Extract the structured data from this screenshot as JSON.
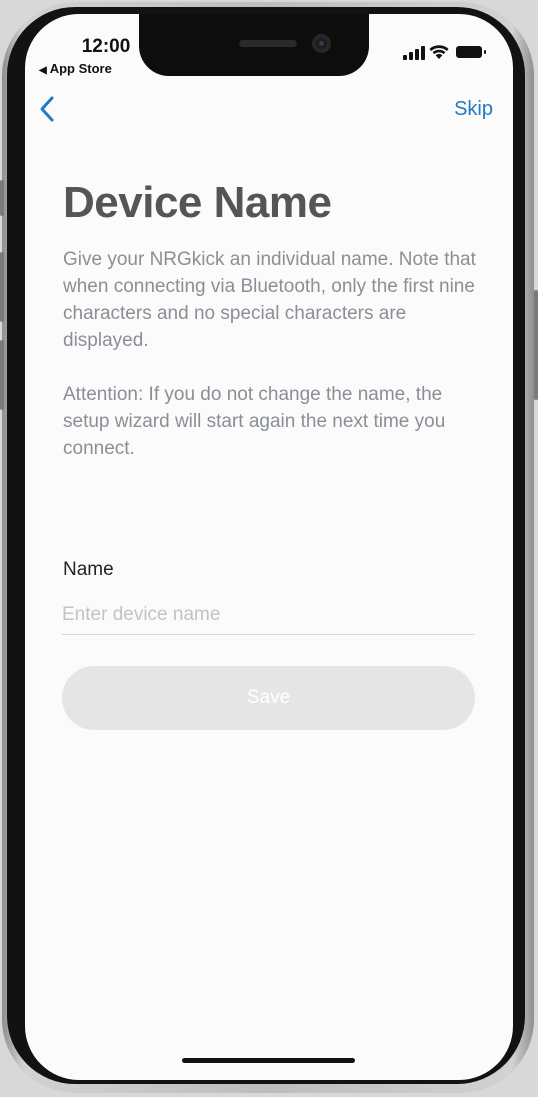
{
  "status_bar": {
    "time": "12:00",
    "back_app_label": "App Store",
    "back_app_icon": "triangle-left-icon",
    "signal_icon": "cellular-signal-icon",
    "wifi_icon": "wifi-icon",
    "battery_icon": "battery-icon"
  },
  "nav": {
    "back_icon": "chevron-left-icon",
    "skip_label": "Skip",
    "accent_color": "#1f7ac4"
  },
  "content": {
    "title": "Device Name",
    "description_1": "Give your NRGkick an individual name. Note that when connecting via Bluetooth, only the first nine characters and no special characters are displayed.",
    "description_2": "Attention: If you do not change the name, the setup wizard will start again the next time you connect."
  },
  "form": {
    "name_label": "Name",
    "name_value": "",
    "name_placeholder": "Enter device name",
    "save_label": "Save",
    "save_enabled": false
  }
}
